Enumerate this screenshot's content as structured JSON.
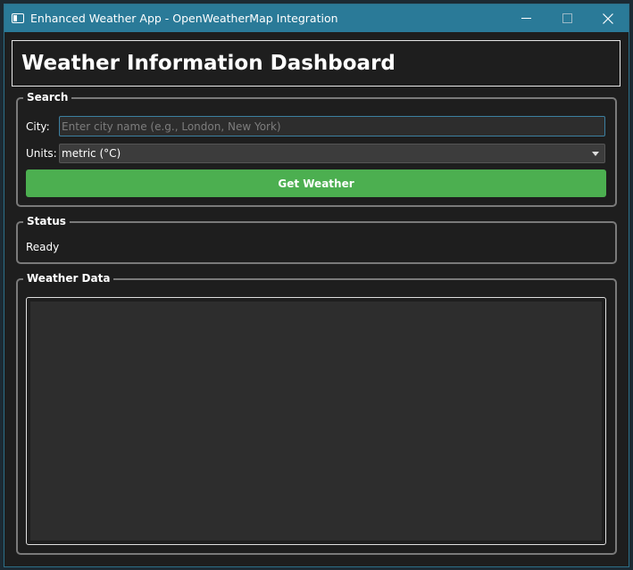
{
  "window": {
    "title": "Enhanced Weather App - OpenWeatherMap Integration",
    "icon": "app-window-icon",
    "controls": [
      "minimize-icon",
      "maximize-icon",
      "close-icon"
    ]
  },
  "header": {
    "title": "Weather Information Dashboard"
  },
  "search": {
    "group_title": "Search",
    "city_label": "City:",
    "city_value": "",
    "city_placeholder": "Enter city name (e.g., London, New York)",
    "units_label": "Units:",
    "units_selected": "metric (°C)",
    "button_label": "Get Weather"
  },
  "status": {
    "group_title": "Status",
    "text": "Ready"
  },
  "weather_data": {
    "group_title": "Weather Data",
    "content": ""
  },
  "colors": {
    "titlebar": "#2a7a98",
    "background": "#1e1e1e",
    "button": "#4caf50",
    "input_focus_border": "#3c7fa0"
  }
}
